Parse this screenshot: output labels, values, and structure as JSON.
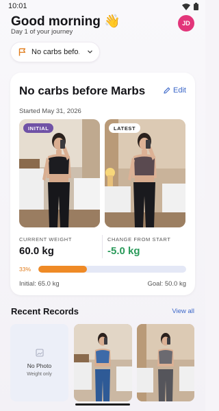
{
  "status_bar": {
    "time": "10:01"
  },
  "header": {
    "greeting": "Good morning 👋",
    "subtitle": "Day 1 of your journey",
    "avatar_initials": "JD"
  },
  "goal_selector": {
    "selected": "No carbs befo..."
  },
  "journey_card": {
    "title": "No carbs before Marbs",
    "edit_label": "Edit",
    "started": "Started May 31, 2026",
    "initial_badge": "INITIAL",
    "latest_badge": "LATEST",
    "current_weight_label": "CURRENT WEIGHT",
    "current_weight": "60.0 kg",
    "change_label": "CHANGE FROM START",
    "change": "-5.0 kg",
    "progress_label": "33%",
    "progress_fraction": 0.33,
    "initial_weight": "Initial: 65.0 kg",
    "goal_weight": "Goal: 50.0 kg"
  },
  "recent_records": {
    "title": "Recent Records",
    "view_all": "View all",
    "no_photo_title": "No Photo",
    "no_photo_sub": "Weight only"
  },
  "colors": {
    "accent_blue": "#3a66c8",
    "avatar": "#e2357a",
    "initial_badge": "#7052a6",
    "progress_fill": "#ef8a26",
    "change_green": "#2a9a5a"
  },
  "icons": [
    "wifi-icon",
    "battery-icon",
    "flag-icon",
    "chevron-down-icon",
    "pencil-icon",
    "image-icon"
  ]
}
